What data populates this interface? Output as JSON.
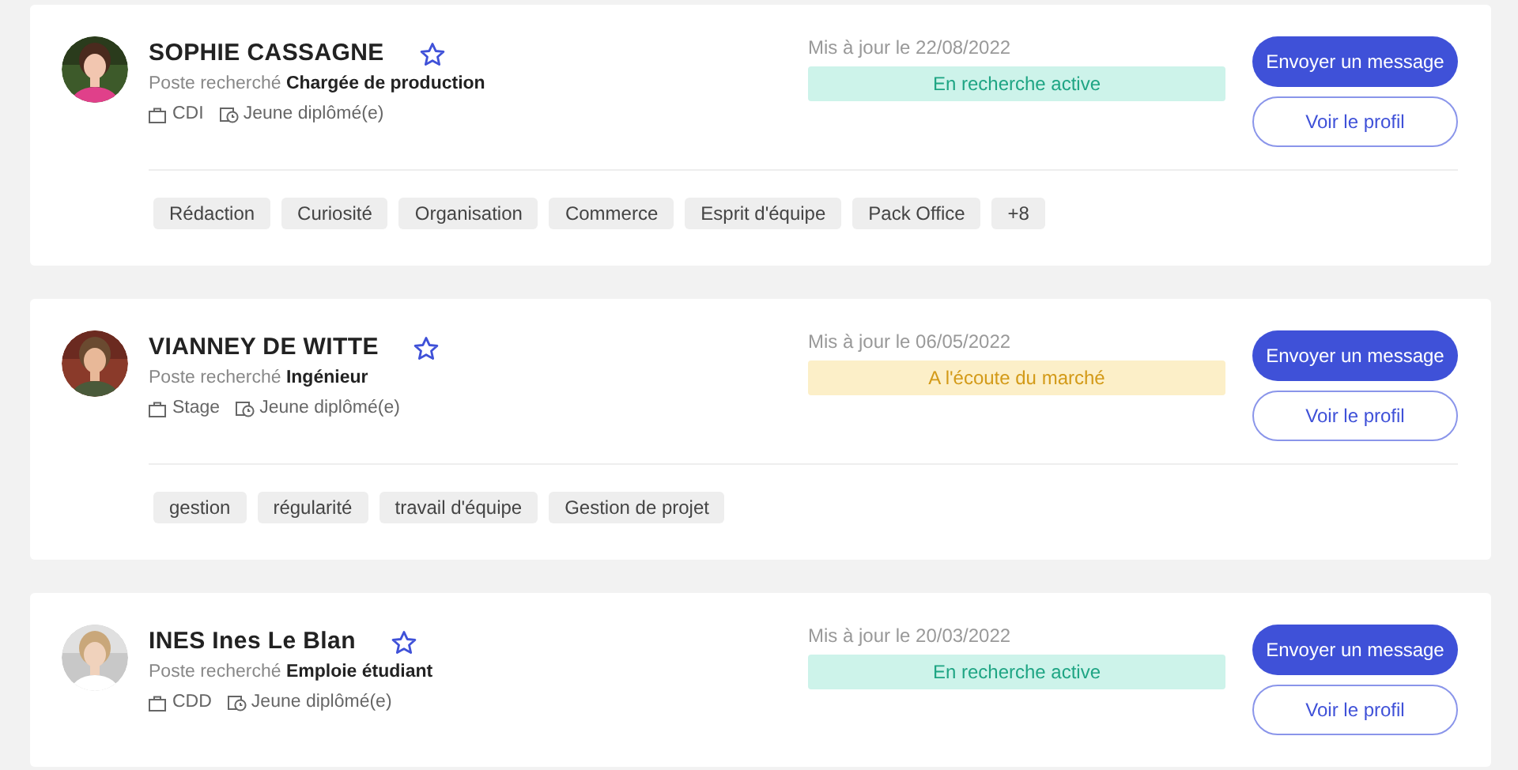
{
  "candidates": [
    {
      "name": "SOPHIE CASSAGNE",
      "favorite": false,
      "avatar": {
        "kind": "picture"
      },
      "position_label": "Poste recherché",
      "position": "Chargée de production",
      "contract": "CDI",
      "experience": "Jeune diplômé(e)",
      "updated": "Mis à jour le 22/08/2022",
      "status": {
        "kind": "active",
        "label": "En recherche active"
      },
      "buttons": [
        "Envoyer un message",
        "Voir le profil"
      ],
      "tags": [
        "Rédaction",
        "Curiosité",
        "Organisation",
        "Commerce",
        "Esprit d'équipe",
        "Pack Office",
        "+8"
      ]
    },
    {
      "name": "VIANNEY DE WITTE",
      "favorite": false,
      "avatar": {
        "kind": "picture"
      },
      "position_label": "Poste recherché",
      "position": "Ingénieur",
      "contract": "Stage",
      "experience": "Jeune diplômé(e)",
      "updated": "Mis à jour le 06/05/2022",
      "status": {
        "kind": "listening",
        "label": "A l'écoute du marché"
      },
      "buttons": [
        "Envoyer un message",
        "Voir le profil"
      ],
      "tags": [
        "gestion",
        "régularité",
        "travail d'équipe",
        "Gestion de projet"
      ]
    },
    {
      "name": "INES Ines Le Blan",
      "favorite": false,
      "avatar": {
        "kind": "picture"
      },
      "position_label": "Poste recherché",
      "position": "Emploie étudiant",
      "contract": "CDD",
      "experience": "Jeune diplômé(e)",
      "updated": "Mis à jour le 20/03/2022",
      "status": {
        "kind": "active",
        "label": "En recherche active"
      },
      "buttons": [
        "Envoyer un message",
        "Voir le profil"
      ]
    }
  ]
}
